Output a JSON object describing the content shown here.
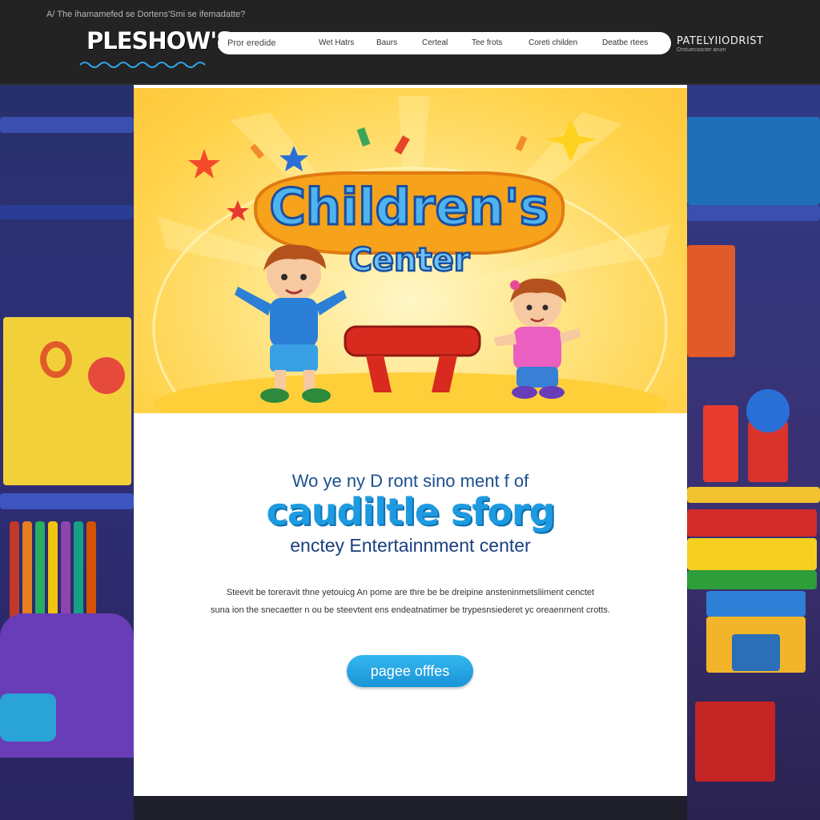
{
  "header": {
    "caption": "A/ The ihamamefed se Dortens'Smi se ifemadatte?",
    "logo": "PLESHOW'S",
    "search": {
      "value": "",
      "placeholder": "Pror eredide"
    },
    "nav": [
      "Wet Hatrs",
      "Baurs",
      "Certeal",
      "Tee frots",
      "Coreti childen",
      "Deatbe rtees"
    ],
    "brand": "PATELYIIODRIST",
    "brand_sub": "Orstuecsocter arum"
  },
  "hero": {
    "title_line1": "Children's",
    "title_line2": "Center"
  },
  "content": {
    "tagline": "Wo ye ny D ront sino ment f of",
    "headline": "caudiltle sforg",
    "subhead": "enctey Entertainnment center",
    "body": [
      "Steevit be toreravit thne yetouicg An pome are thre be be dreipine ansteninmetsliiment cenctet",
      "suna ion the snecaetter n ou be steevtent ens endeatnatimer be trypesnsiederet yc oreaenrnent crotts."
    ],
    "cta_label": "pagee offfes"
  },
  "colors": {
    "accent": "#1e9be0",
    "header_bg": "#232323",
    "hero_yellow": "#ffd24a",
    "cta": "#1a94d6"
  }
}
